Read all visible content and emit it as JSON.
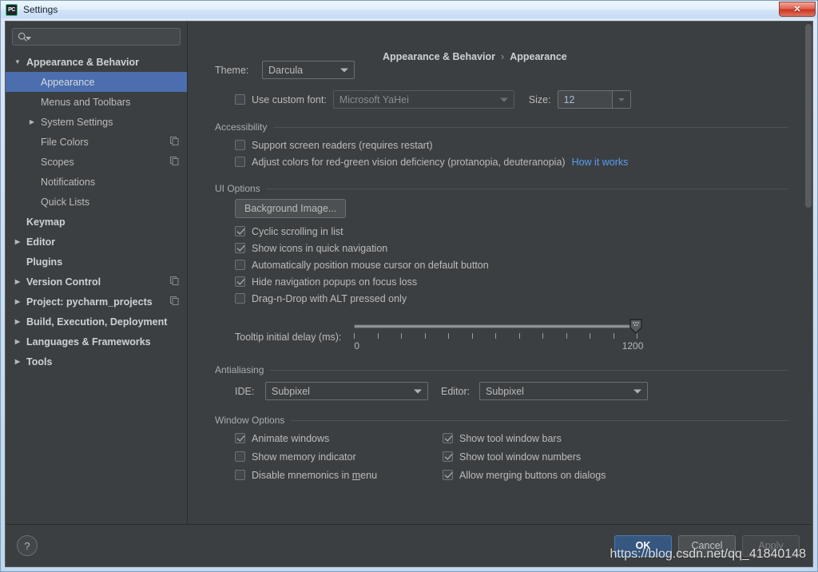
{
  "window": {
    "title": "Settings",
    "app_icon": "pycharm-icon",
    "app_icon_text": "PC",
    "close_label": "✕"
  },
  "sidebar": {
    "search_placeholder": "",
    "search_value": "",
    "items": [
      {
        "label": "Appearance & Behavior",
        "indent": 0,
        "arrow": "▼",
        "bold": true,
        "selected": false,
        "copy_icon": false
      },
      {
        "label": "Appearance",
        "indent": 1,
        "arrow": "",
        "bold": false,
        "selected": true,
        "copy_icon": false
      },
      {
        "label": "Menus and Toolbars",
        "indent": 1,
        "arrow": "",
        "bold": false,
        "selected": false,
        "copy_icon": false
      },
      {
        "label": "System Settings",
        "indent": 1,
        "arrow": "▶",
        "bold": false,
        "selected": false,
        "copy_icon": false
      },
      {
        "label": "File Colors",
        "indent": 1,
        "arrow": "",
        "bold": false,
        "selected": false,
        "copy_icon": true
      },
      {
        "label": "Scopes",
        "indent": 1,
        "arrow": "",
        "bold": false,
        "selected": false,
        "copy_icon": true
      },
      {
        "label": "Notifications",
        "indent": 1,
        "arrow": "",
        "bold": false,
        "selected": false,
        "copy_icon": false
      },
      {
        "label": "Quick Lists",
        "indent": 1,
        "arrow": "",
        "bold": false,
        "selected": false,
        "copy_icon": false
      },
      {
        "label": "Keymap",
        "indent": 0,
        "arrow": "",
        "bold": true,
        "selected": false,
        "copy_icon": false
      },
      {
        "label": "Editor",
        "indent": 0,
        "arrow": "▶",
        "bold": true,
        "selected": false,
        "copy_icon": false
      },
      {
        "label": "Plugins",
        "indent": 0,
        "arrow": "",
        "bold": true,
        "selected": false,
        "copy_icon": false
      },
      {
        "label": "Version Control",
        "indent": 0,
        "arrow": "▶",
        "bold": true,
        "selected": false,
        "copy_icon": true
      },
      {
        "label": "Project: pycharm_projects",
        "indent": 0,
        "arrow": "▶",
        "bold": true,
        "selected": false,
        "copy_icon": true
      },
      {
        "label": "Build, Execution, Deployment",
        "indent": 0,
        "arrow": "▶",
        "bold": true,
        "selected": false,
        "copy_icon": false
      },
      {
        "label": "Languages & Frameworks",
        "indent": 0,
        "arrow": "▶",
        "bold": true,
        "selected": false,
        "copy_icon": false
      },
      {
        "label": "Tools",
        "indent": 0,
        "arrow": "▶",
        "bold": true,
        "selected": false,
        "copy_icon": false
      }
    ]
  },
  "breadcrumb": {
    "parent": "Appearance & Behavior",
    "separator": "›",
    "current": "Appearance"
  },
  "theme": {
    "label": "Theme:",
    "value": "Darcula",
    "custom_font_label": "Use custom font:",
    "custom_font_checked": false,
    "font_value": "Microsoft YaHei",
    "size_label": "Size:",
    "size_value": "12"
  },
  "accessibility": {
    "group_title": "Accessibility",
    "items": [
      {
        "label": "Support screen readers (requires restart)",
        "checked": false
      },
      {
        "label": "Adjust colors for red-green vision deficiency (protanopia, deuteranopia)",
        "checked": false
      }
    ],
    "link_label": "How it works"
  },
  "ui_options": {
    "group_title": "UI Options",
    "background_image_button": "Background Image...",
    "items": [
      {
        "label": "Cyclic scrolling in list",
        "checked": true
      },
      {
        "label": "Show icons in quick navigation",
        "checked": true
      },
      {
        "label": "Automatically position mouse cursor on default button",
        "checked": false
      },
      {
        "label": "Hide navigation popups on focus loss",
        "checked": true
      },
      {
        "label": "Drag-n-Drop with ALT pressed only",
        "checked": false
      }
    ],
    "slider": {
      "label": "Tooltip initial delay (ms):",
      "min_label": "0",
      "max_label": "1200",
      "min": 0,
      "max": 1200,
      "value": 1200,
      "tick_count": 13
    }
  },
  "antialiasing": {
    "group_title": "Antialiasing",
    "ide_label": "IDE:",
    "ide_value": "Subpixel",
    "editor_label": "Editor:",
    "editor_value": "Subpixel"
  },
  "window_options": {
    "group_title": "Window Options",
    "left": [
      {
        "label": "Animate windows",
        "checked": true,
        "mnemonic": ""
      },
      {
        "label": "Show memory indicator",
        "checked": false,
        "mnemonic": ""
      },
      {
        "label": "Disable mnemonics in menu",
        "checked": false,
        "mnemonic": "m"
      }
    ],
    "right": [
      {
        "label": "Show tool window bars",
        "checked": true
      },
      {
        "label": "Show tool window numbers",
        "checked": true
      },
      {
        "label": "Allow merging buttons on dialogs",
        "checked": true
      }
    ]
  },
  "footer": {
    "help_label": "?",
    "ok_label": "OK",
    "cancel_label": "Cancel",
    "apply_label": "Apply"
  },
  "watermark": {
    "text": "https://blog.csdn.net/qq_41840148"
  },
  "colors": {
    "accent": "#4b6eaf",
    "primary_button": "#365880",
    "link": "#589df6",
    "panel_bg": "#3c3f41",
    "text": "#bbbbbb"
  }
}
